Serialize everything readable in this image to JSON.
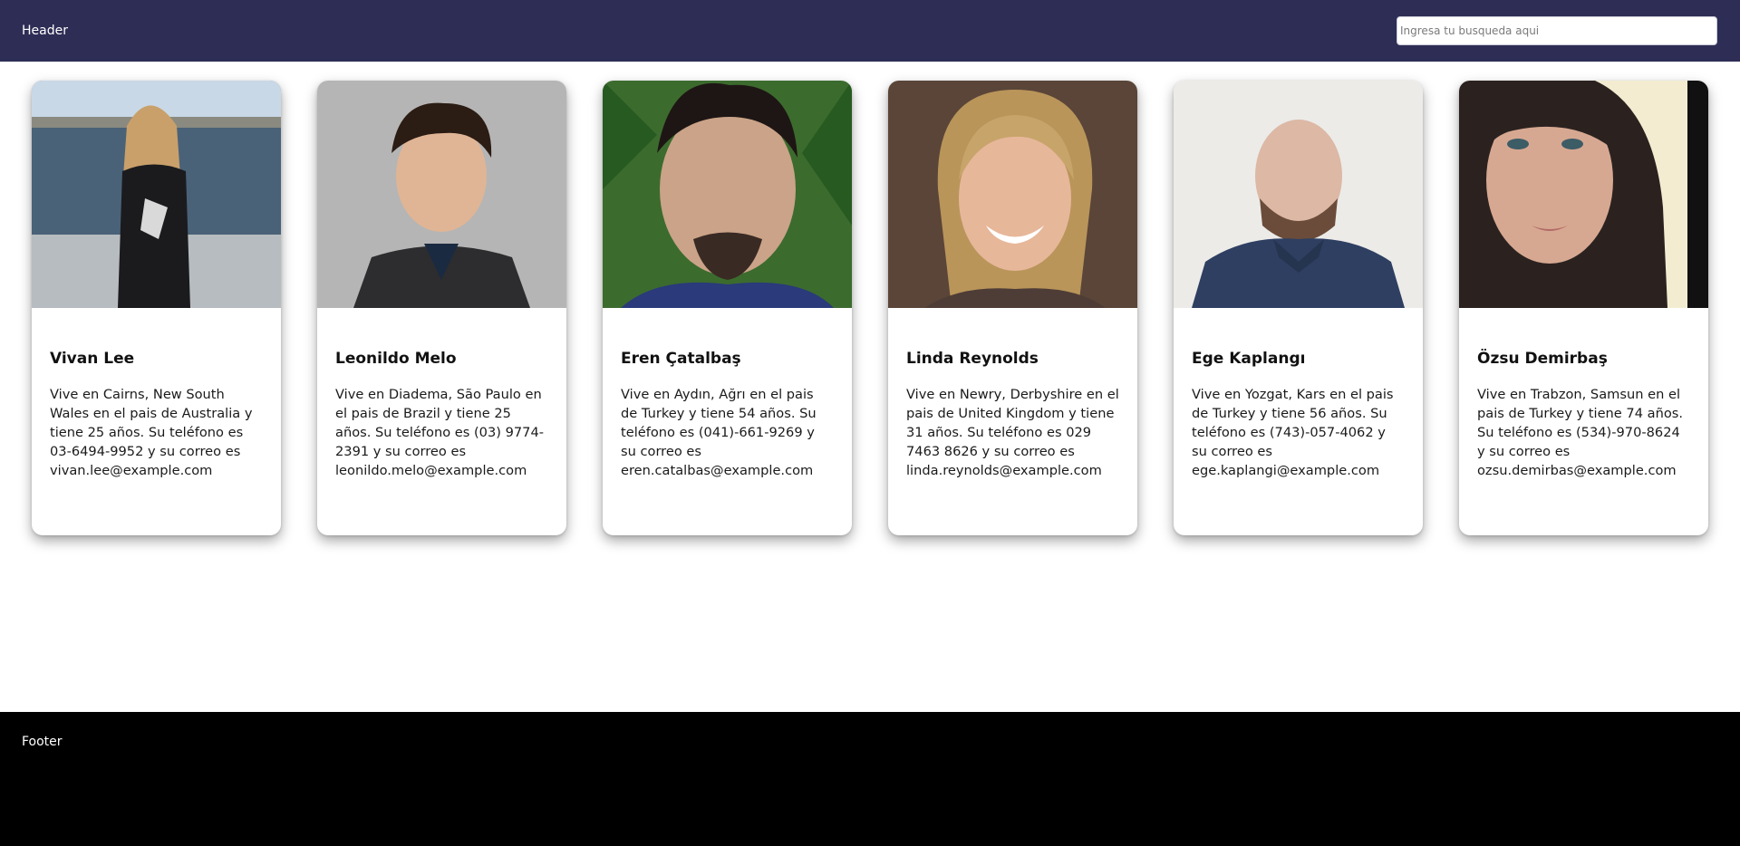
{
  "header": {
    "title": "Header",
    "search_placeholder": "Ingresa tu busqueda aqui"
  },
  "footer": {
    "title": "Footer"
  },
  "colors": {
    "header_bg": "#2e2d55",
    "footer_bg": "#000000"
  },
  "people": [
    {
      "name": "Vivan Lee",
      "description": "Vive en Cairns, New South Wales en el pais de Australia y tiene 25 años. Su teléfono es 03-6494-9952 y su correo es vivan.lee@example.com"
    },
    {
      "name": "Leonildo Melo",
      "description": "Vive en Diadema, São Paulo en el pais de Brazil y tiene 25 años. Su teléfono es (03) 9774-2391 y su correo es leonildo.melo@example.com"
    },
    {
      "name": "Eren Çatalbaş",
      "description": "Vive en Aydın, Ağrı en el pais de Turkey y tiene 54 años. Su teléfono es (041)-661-9269 y su correo es eren.catalbas@example.com"
    },
    {
      "name": "Linda Reynolds",
      "description": "Vive en Newry, Derbyshire en el pais de United Kingdom y tiene 31 años. Su teléfono es 029 7463 8626 y su correo es linda.reynolds@example.com"
    },
    {
      "name": "Ege Kaplangı",
      "description": "Vive en Yozgat, Kars en el pais de Turkey y tiene 56 años. Su teléfono es (743)-057-4062 y su correo es ege.kaplangi@example.com"
    },
    {
      "name": "Özsu Demirbaş",
      "description": "Vive en Trabzon, Samsun en el pais de Turkey y tiene 74 años. Su teléfono es (534)-970-8624 y su correo es ozsu.demirbas@example.com"
    }
  ]
}
